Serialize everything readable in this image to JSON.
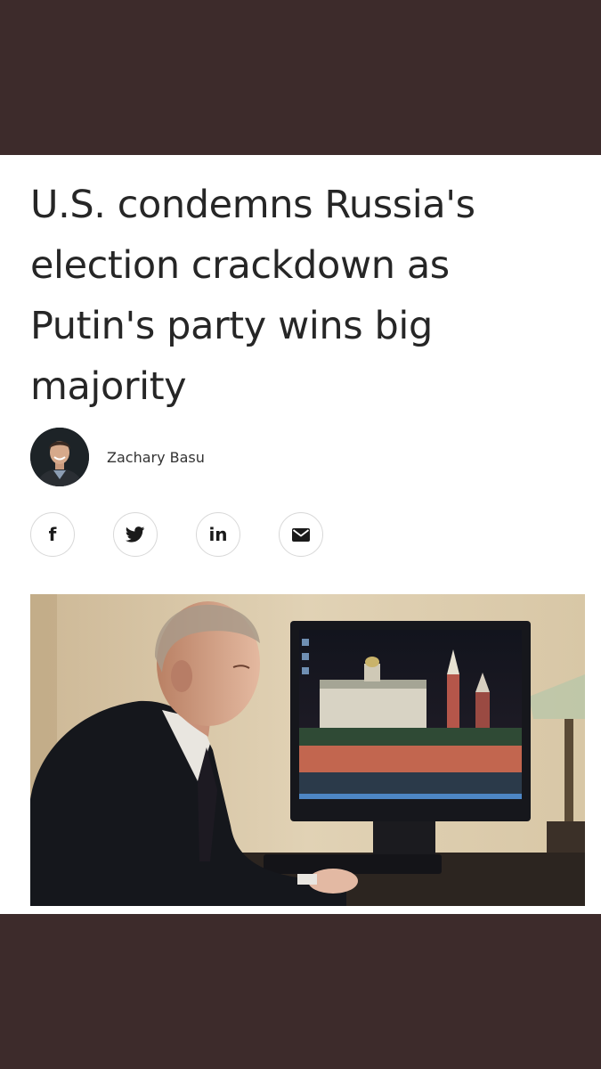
{
  "article": {
    "headline": "U.S. condemns Russia's election crackdown as Putin's party wins big majority",
    "author": {
      "name": "Zachary Basu",
      "avatar_icon": "author-portrait"
    }
  },
  "share": {
    "buttons": [
      {
        "network": "facebook",
        "icon": "facebook-icon",
        "glyph": "f"
      },
      {
        "network": "twitter",
        "icon": "twitter-icon"
      },
      {
        "network": "linkedin",
        "icon": "linkedin-icon",
        "glyph": "in"
      },
      {
        "network": "email",
        "icon": "email-icon"
      }
    ]
  },
  "hero_image": {
    "subject": "photo"
  },
  "colors": {
    "frame": "#3d2b2b",
    "card": "#ffffff",
    "headline_text": "#262626",
    "share_border": "#d8d8d8"
  }
}
